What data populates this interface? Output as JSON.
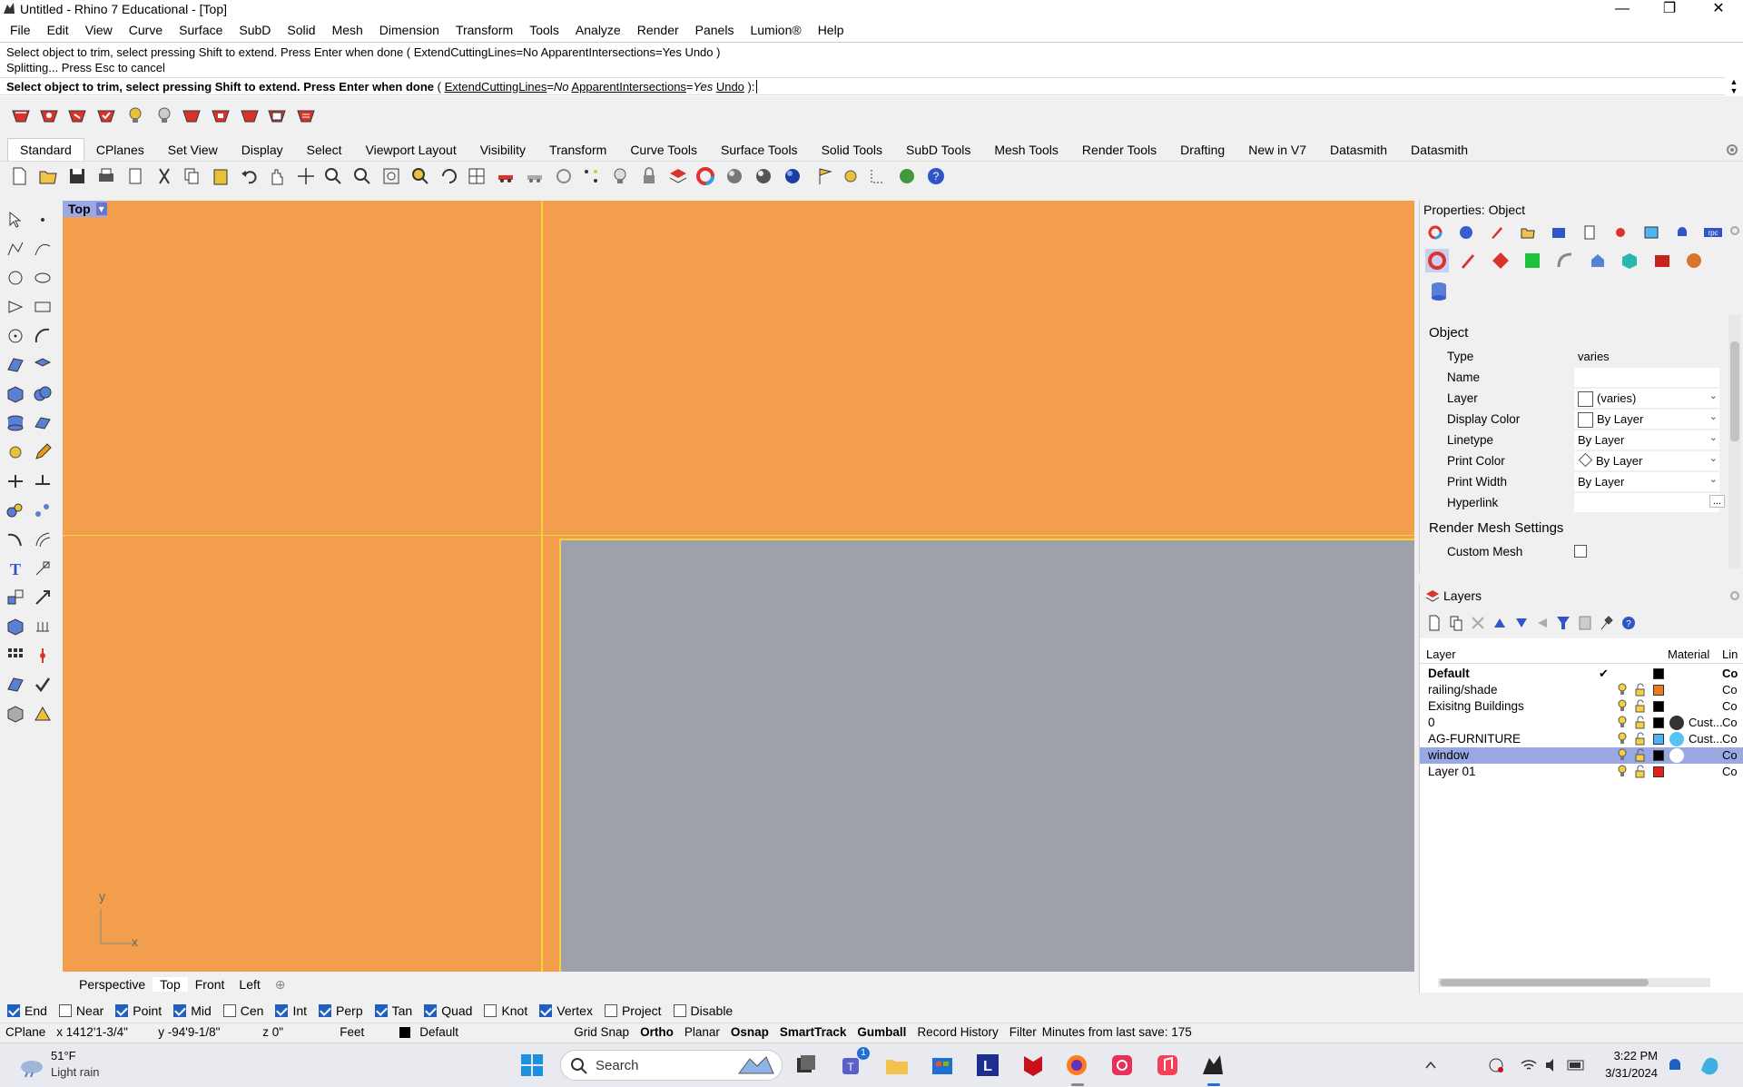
{
  "window": {
    "title": "Untitled - Rhino 7 Educational - [Top]",
    "minimize": "—",
    "maximize": "❐",
    "close": "✕"
  },
  "menu": [
    "File",
    "Edit",
    "View",
    "Curve",
    "Surface",
    "SubD",
    "Solid",
    "Mesh",
    "Dimension",
    "Transform",
    "Tools",
    "Analyze",
    "Render",
    "Panels",
    "Lumion®",
    "Help"
  ],
  "command": {
    "history1": "Select object to trim, select pressing Shift to extend. Press Enter when done ( ExtendCuttingLines=No  ApparentIntersections=Yes  Undo )",
    "history2": "Splitting... Press Esc to cancel",
    "prompt_main": "Select object to trim, select pressing Shift to extend. Press Enter when done",
    "prompt_opts_open": " ( ",
    "opt1_name": "ExtendCuttingLines",
    "opt1_eq": "=",
    "opt1_val": "No",
    "opt2_name": "ApparentIntersections",
    "opt2_eq": "=",
    "opt2_val": "Yes",
    "opt3_name": "Undo",
    "prompt_close": " ):"
  },
  "tabs": [
    "Standard",
    "CPlanes",
    "Set View",
    "Display",
    "Select",
    "Viewport Layout",
    "Visibility",
    "Transform",
    "Curve Tools",
    "Surface Tools",
    "Solid Tools",
    "SubD Tools",
    "Mesh Tools",
    "Render Tools",
    "Drafting",
    "New in V7",
    "Datasmith",
    "Datasmith"
  ],
  "viewport": {
    "name": "Top",
    "dropdown": "▾",
    "axis_x": "x",
    "axis_y": "y"
  },
  "view_tabs": [
    "Perspective",
    "Top",
    "Front",
    "Left"
  ],
  "view_tabs_add": "⊕",
  "osnaps": [
    {
      "label": "End",
      "checked": true
    },
    {
      "label": "Near",
      "checked": false
    },
    {
      "label": "Point",
      "checked": true
    },
    {
      "label": "Mid",
      "checked": true
    },
    {
      "label": "Cen",
      "checked": false
    },
    {
      "label": "Int",
      "checked": true
    },
    {
      "label": "Perp",
      "checked": true
    },
    {
      "label": "Tan",
      "checked": true
    },
    {
      "label": "Quad",
      "checked": true
    },
    {
      "label": "Knot",
      "checked": false
    },
    {
      "label": "Vertex",
      "checked": true
    },
    {
      "label": "Project",
      "checked": false
    },
    {
      "label": "Disable",
      "checked": false
    }
  ],
  "status": {
    "cplane": "CPlane",
    "x": "x 1412'1-3/4\"",
    "y": "y -94'9-1/8\"",
    "z": "z 0\"",
    "units": "Feet",
    "layer": "Default",
    "grid_snap": "Grid Snap",
    "ortho": "Ortho",
    "planar": "Planar",
    "osnap": "Osnap",
    "smarttrack": "SmartTrack",
    "gumball": "Gumball",
    "record_history": "Record History",
    "filter": "Filter",
    "save_info": "Minutes from last save: 175"
  },
  "properties": {
    "title": "Properties: Object",
    "section_object": "Object",
    "rows": [
      {
        "key": "Type",
        "value": "varies"
      },
      {
        "key": "Name",
        "value": ""
      },
      {
        "key": "Layer",
        "value": "(varies)"
      },
      {
        "key": "Display Color",
        "value": "By Layer"
      },
      {
        "key": "Linetype",
        "value": "By Layer"
      },
      {
        "key": "Print Color",
        "value": "By Layer"
      },
      {
        "key": "Print Width",
        "value": "By Layer"
      },
      {
        "key": "Hyperlink",
        "value": ""
      }
    ],
    "ellipsis": "...",
    "section_render": "Render Mesh Settings",
    "custom_mesh": "Custom Mesh"
  },
  "layers": {
    "title": "Layers",
    "col_layer": "Layer",
    "col_material": "Material",
    "col_linetype": "Lin",
    "check_mark": "✔",
    "rows": [
      {
        "name": "Default",
        "bold": true,
        "current": true,
        "color": "#000000",
        "material": "",
        "mat_color": "",
        "linetype": "Co"
      },
      {
        "name": "railing/shade",
        "color": "#f07a1a",
        "material": "",
        "mat_color": "",
        "linetype": "Co"
      },
      {
        "name": "Exisitng Buildings",
        "color": "#000000",
        "material": "",
        "mat_color": "",
        "linetype": "Co"
      },
      {
        "name": "0",
        "color": "#000000",
        "material": "Cust...",
        "mat_color": "#333333",
        "linetype": "Co"
      },
      {
        "name": "AG-FURNITURE",
        "color": "#4fb5f0",
        "material": "Cust...",
        "mat_color": "#58c2f2",
        "linetype": "Co"
      },
      {
        "name": "window",
        "color": "#000000",
        "material": "",
        "mat_color": "#ffffff",
        "linetype": "Co",
        "selected": true
      },
      {
        "name": "Layer 01",
        "color": "#e8201a",
        "material": "",
        "mat_color": "",
        "linetype": "Co"
      }
    ]
  },
  "taskbar": {
    "temp": "51°F",
    "weather": "Light rain",
    "search": "Search",
    "time": "3:22 PM",
    "date": "3/31/2024",
    "teams_badge": "1"
  },
  "colors": {
    "viewport_bg": "#f29e4c",
    "gray_surface": "#9ea2a8",
    "selection": "#99a8e3",
    "grid_accent": "#f5d040"
  }
}
